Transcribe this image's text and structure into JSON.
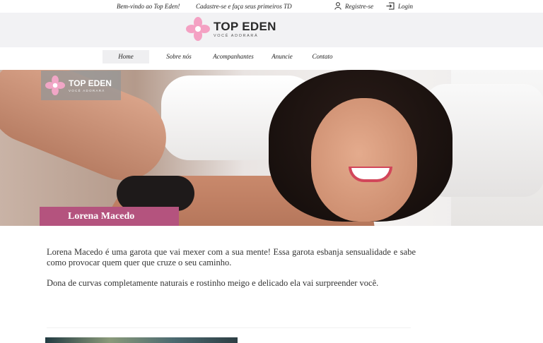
{
  "topbar": {
    "welcome": "Bem-vindo ao Top Eden!",
    "promo": "Cadastre-se e faça seus primeiros TD",
    "register": "Registre-se",
    "login": "Login",
    "register_icon": "user-icon",
    "login_icon": "login-icon"
  },
  "header": {
    "brand": "TOP EDEN",
    "tagline": "VOCÊ ADORARÁ",
    "logo_icon": "flower-logo-icon",
    "logo_color": "#f4a1c3"
  },
  "nav": {
    "items": [
      {
        "label": "Home",
        "active": true
      },
      {
        "label": "Sobre nós",
        "active": false
      },
      {
        "label": "Acompanhantes",
        "active": false
      },
      {
        "label": "Anuncie",
        "active": false
      },
      {
        "label": "Contato",
        "active": false
      }
    ]
  },
  "hero": {
    "logo_brand": "TOP EDEN",
    "logo_tagline": "VOCÊ ADORARÁ",
    "name": "Lorena Macedo",
    "banner_color": "#b4537e"
  },
  "content": {
    "paragraphs": [
      "Lorena Macedo é uma garota que vai mexer com a sua mente! Essa garota esbanja sensualidade e sabe como provocar quem quer que cruze o seu caminho.",
      "Dona de curvas completamente naturais e rostinho meigo e delicado ela vai surpreender você."
    ]
  }
}
